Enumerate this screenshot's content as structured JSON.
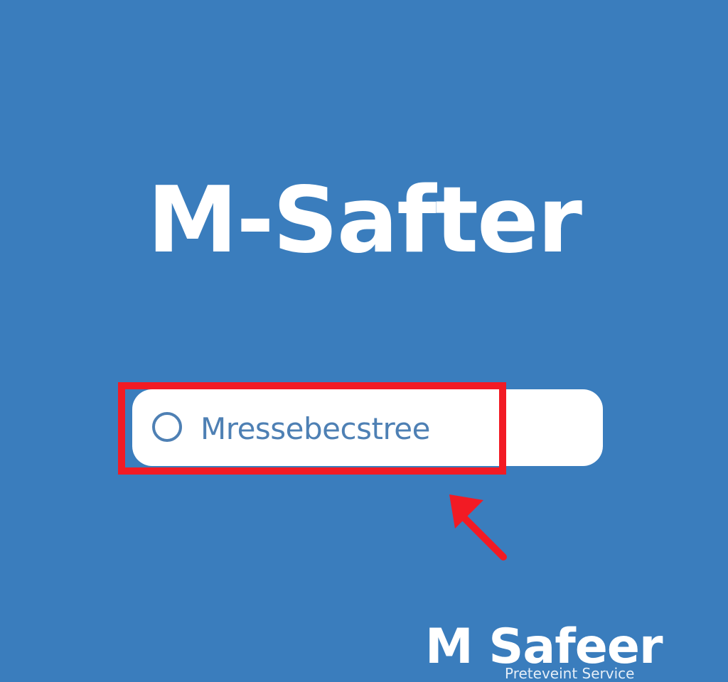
{
  "app": {
    "title": "M-Safter"
  },
  "search": {
    "value": "Mressebecstree",
    "radio_icon": "radio-circle-icon"
  },
  "annotation": {
    "highlight_color": "#f21b24",
    "arrow_icon": "arrow-up-left-icon"
  },
  "brand": {
    "name": "M Safeer",
    "tagline": "Preteveint Service",
    "logo_icon": "brand-logo-icon"
  },
  "colors": {
    "background": "#3a7dbd",
    "pill": "#ffffff",
    "accent_text": "#4e80b4",
    "annotation": "#f21b24"
  }
}
